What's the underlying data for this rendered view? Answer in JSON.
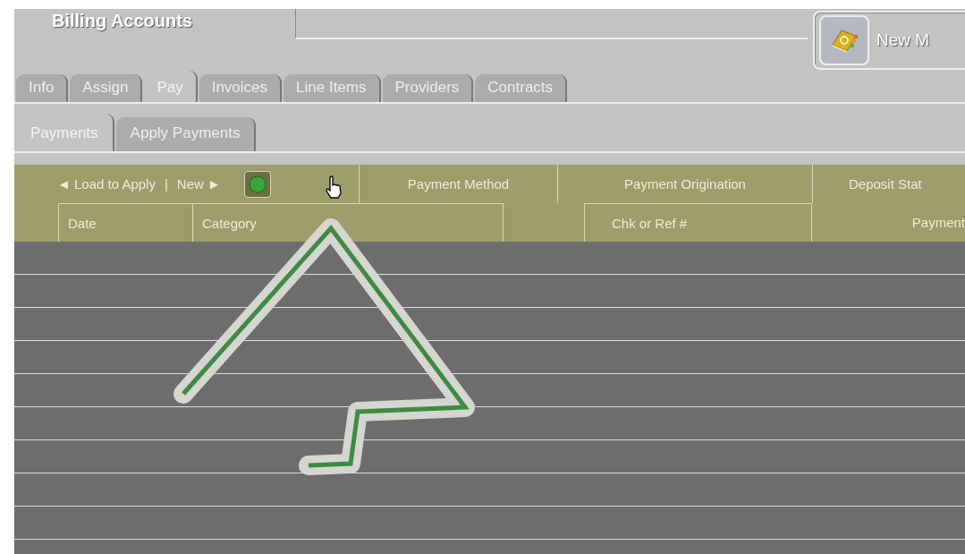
{
  "window": {
    "title": "Billing Accounts"
  },
  "new_button": {
    "label": "New M"
  },
  "tabs": [
    {
      "label": "Info",
      "selected": false
    },
    {
      "label": "Assign",
      "selected": false
    },
    {
      "label": "Pay",
      "selected": true
    },
    {
      "label": "Invoices",
      "selected": false
    },
    {
      "label": "Line Items",
      "selected": false
    },
    {
      "label": "Providers",
      "selected": false
    },
    {
      "label": "Contracts",
      "selected": false
    }
  ],
  "subtabs": [
    {
      "label": "Payments",
      "selected": true
    },
    {
      "label": "Apply Payments",
      "selected": false
    }
  ],
  "toolbar": {
    "load_to_apply": "◄ Load to Apply",
    "separator": "|",
    "new": "New ►"
  },
  "table": {
    "header_top": [
      "Payment Method",
      "Payment Origination",
      "Deposit Stat"
    ],
    "columns": [
      "Date",
      "Category",
      "Chk or Ref #",
      "Payment"
    ]
  }
}
